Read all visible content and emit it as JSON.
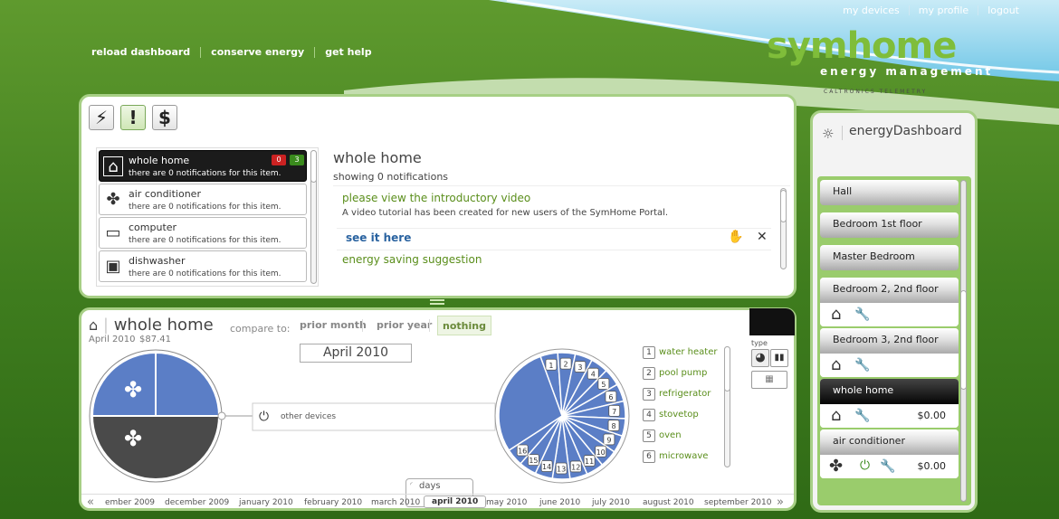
{
  "header": {
    "top_links": [
      "my devices",
      "my profile",
      "logout"
    ],
    "nav_links": [
      "reload dashboard",
      "conserve energy",
      "get help"
    ],
    "logo": {
      "name": "symhome",
      "tagline": "energy management",
      "credit": "CALTRONICS  TELEMETRY"
    }
  },
  "notifications": {
    "toolbar_icons": [
      "lightning-icon",
      "exclamation-icon",
      "dollar-icon"
    ],
    "items": [
      {
        "title": "whole home",
        "subtitle": "there are 0 notifications for this item.",
        "badge_red": "0",
        "badge_green": "3",
        "icon": "house-icon"
      },
      {
        "title": "air conditioner",
        "subtitle": "there are 0 notifications for this item.",
        "icon": "fan-icon"
      },
      {
        "title": "computer",
        "subtitle": "there are 0 notifications for this item.",
        "icon": "computer-icon"
      },
      {
        "title": "dishwasher",
        "subtitle": "there are 0 notifications for this item.",
        "icon": "dishwasher-icon"
      }
    ],
    "detail": {
      "title": "whole home",
      "count_text": "showing 0 notifications",
      "entries": [
        {
          "heading": "please view the introductory video",
          "body": "A video tutorial has been created for new users of the SymHome Portal.",
          "link": "see it here"
        },
        {
          "heading": "energy saving suggestion"
        }
      ]
    }
  },
  "chart_panel": {
    "title": "whole home",
    "date": "April 2010",
    "amount": "$87.41",
    "compare_label": "compare to:",
    "compare_options": [
      "prior month",
      "prior year",
      "nothing"
    ],
    "selected_compare": "nothing",
    "period": "April 2010",
    "other_devices_label": "other devices",
    "type_label": "type",
    "legend": [
      {
        "num": "1",
        "label": "water heater"
      },
      {
        "num": "2",
        "label": "pool pump"
      },
      {
        "num": "3",
        "label": "refrigerator"
      },
      {
        "num": "4",
        "label": "stovetop"
      },
      {
        "num": "5",
        "label": "oven"
      },
      {
        "num": "6",
        "label": "microwave"
      }
    ],
    "timeline": [
      "ember 2009",
      "december 2009",
      "january 2010",
      "february 2010",
      "march 2010",
      "april 2010",
      "may 2010",
      "june 2010",
      "july 2010",
      "august 2010",
      "september 2010"
    ],
    "selected_month": "april 2010",
    "days_label": "days",
    "wheel_numbers": [
      "1",
      "2",
      "3",
      "4",
      "5",
      "6",
      "7",
      "8",
      "9",
      "10",
      "11",
      "12",
      "13",
      "14",
      "15",
      "16"
    ]
  },
  "chart_data": [
    {
      "type": "pie",
      "slices": [
        {
          "value": 25,
          "color": "#5b7ec6"
        },
        {
          "value": 25,
          "color": "#5b7ec6"
        },
        {
          "value": 50,
          "color": "#4a4a4a"
        }
      ]
    },
    {
      "type": "pie",
      "slices": [
        {
          "label": "1",
          "value": 1
        },
        {
          "label": "2",
          "value": 1
        },
        {
          "label": "3",
          "value": 1
        },
        {
          "label": "4",
          "value": 1
        },
        {
          "label": "5",
          "value": 1
        },
        {
          "label": "6",
          "value": 1
        },
        {
          "label": "7",
          "value": 1
        },
        {
          "label": "8",
          "value": 1
        },
        {
          "label": "9",
          "value": 1
        },
        {
          "label": "10",
          "value": 1
        },
        {
          "label": "11",
          "value": 1
        },
        {
          "label": "12",
          "value": 1
        },
        {
          "label": "13",
          "value": 1
        },
        {
          "label": "14",
          "value": 1
        },
        {
          "label": "15",
          "value": 1
        },
        {
          "label": "16",
          "value": 1
        },
        {
          "label": "",
          "value": 6.4
        }
      ]
    }
  ],
  "sidebar": {
    "title": "energyDashboard",
    "rooms": [
      {
        "name": "Hall"
      },
      {
        "name": "Bedroom 1st floor"
      },
      {
        "name": "Master Bedroom"
      },
      {
        "name": "Bedroom 2, 2nd floor"
      },
      {
        "name": "Bedroom 3, 2nd floor"
      },
      {
        "name": "whole home",
        "value": "$0.00"
      },
      {
        "name": "air conditioner",
        "value": "$0.00"
      }
    ]
  },
  "colors": {
    "accent_green": "#7fbd3a",
    "blue_slice": "#5b7ec6",
    "dark_slice": "#4a4a4a",
    "link_blue": "#2a63a0"
  }
}
